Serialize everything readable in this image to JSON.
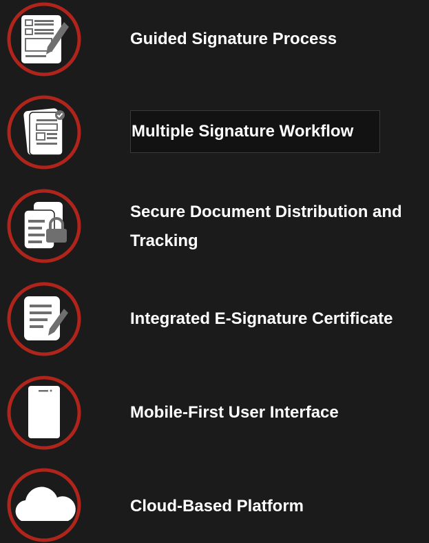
{
  "features": [
    {
      "label": "Guided Signature Process",
      "icon": "document-pen-icon"
    },
    {
      "label": "Multiple Signature Workflow",
      "icon": "multi-document-check-icon"
    },
    {
      "label": "Secure Document Distribution and Tracking",
      "icon": "document-lock-icon"
    },
    {
      "label": "Integrated E-Signature Certificate",
      "icon": "document-signature-icon"
    },
    {
      "label": "Mobile-First User Interface",
      "icon": "mobile-phone-icon"
    },
    {
      "label": "Cloud-Based Platform",
      "icon": "cloud-icon"
    }
  ],
  "colors": {
    "background": "#1b1b1b",
    "ring": "#b0251b",
    "icon_fill": "#ffffff",
    "icon_detail": "#6f6f6f",
    "text": "#ffffff"
  }
}
